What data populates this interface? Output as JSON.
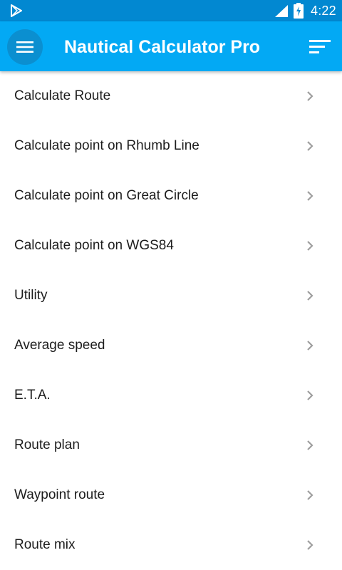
{
  "status_bar": {
    "time": "4:22",
    "left_icon": "play-store-icon",
    "signal_icon": "signal-icon",
    "battery_icon": "battery-charging-icon"
  },
  "app_bar": {
    "title": "Nautical Calculator Pro",
    "menu_icon": "hamburger-menu-icon",
    "sort_icon": "sort-icon",
    "color": "#03a9f4",
    "status_color": "#0288d1"
  },
  "menu": {
    "items": [
      {
        "label": "Calculate Route"
      },
      {
        "label": "Calculate point on Rhumb Line"
      },
      {
        "label": "Calculate point on Great Circle"
      },
      {
        "label": "Calculate point on WGS84"
      },
      {
        "label": "Utility"
      },
      {
        "label": "Average speed"
      },
      {
        "label": "E.T.A."
      },
      {
        "label": "Route plan"
      },
      {
        "label": "Waypoint route"
      },
      {
        "label": "Route mix"
      }
    ],
    "chevron_icon": "chevron-right-icon"
  }
}
